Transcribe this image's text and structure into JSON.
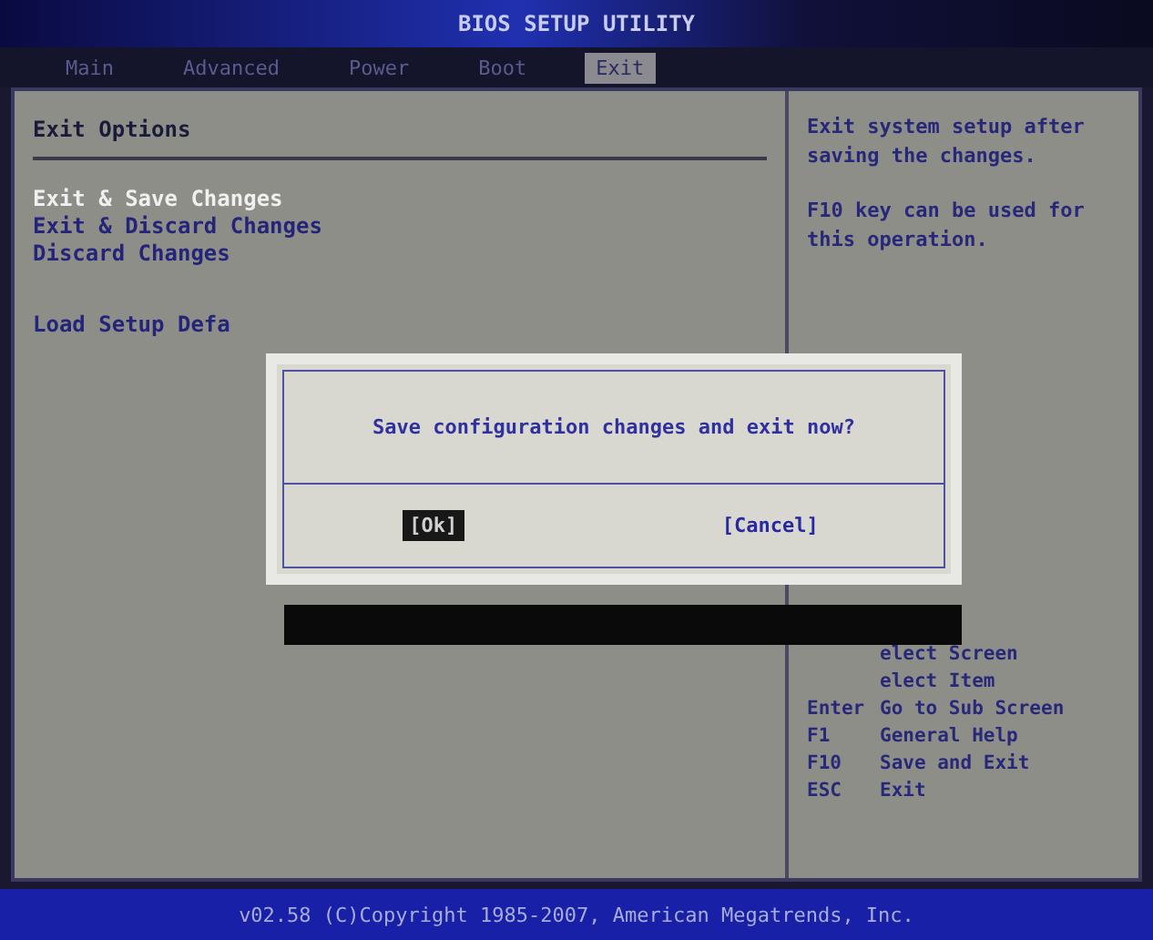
{
  "window": {
    "title": "BIOS SETUP UTILITY"
  },
  "tabs": [
    {
      "label": "Main",
      "selected": false
    },
    {
      "label": "Advanced",
      "selected": false
    },
    {
      "label": "Power",
      "selected": false
    },
    {
      "label": "Boot",
      "selected": false
    },
    {
      "label": "Exit",
      "selected": true
    }
  ],
  "section_title": "Exit Options",
  "menu_items": [
    {
      "label": "Exit & Save Changes",
      "selected": true
    },
    {
      "label": "Exit & Discard Changes",
      "selected": false
    },
    {
      "label": "Discard Changes",
      "selected": false
    },
    {
      "label": "Load Setup Defa",
      "selected": false
    }
  ],
  "help_texts": [
    "Exit system setup after saving the changes.",
    "F10 key can be used for this operation."
  ],
  "keys": [
    {
      "action": "elect Screen"
    },
    {
      "action": "elect Item"
    },
    {
      "key": "Enter",
      "action": "Go to Sub Screen"
    },
    {
      "key": "F1",
      "action": "General Help"
    },
    {
      "key": "F10",
      "action": "Save and Exit"
    },
    {
      "key": "ESC",
      "action": "Exit"
    }
  ],
  "dialog": {
    "message": "Save configuration changes and exit now?",
    "buttons": [
      {
        "label": "[Ok]",
        "selected": true
      },
      {
        "label": "[Cancel]",
        "selected": false
      }
    ]
  },
  "status_bar": "v02.58 (C)Copyright 1985-2007, American Megatrends, Inc."
}
